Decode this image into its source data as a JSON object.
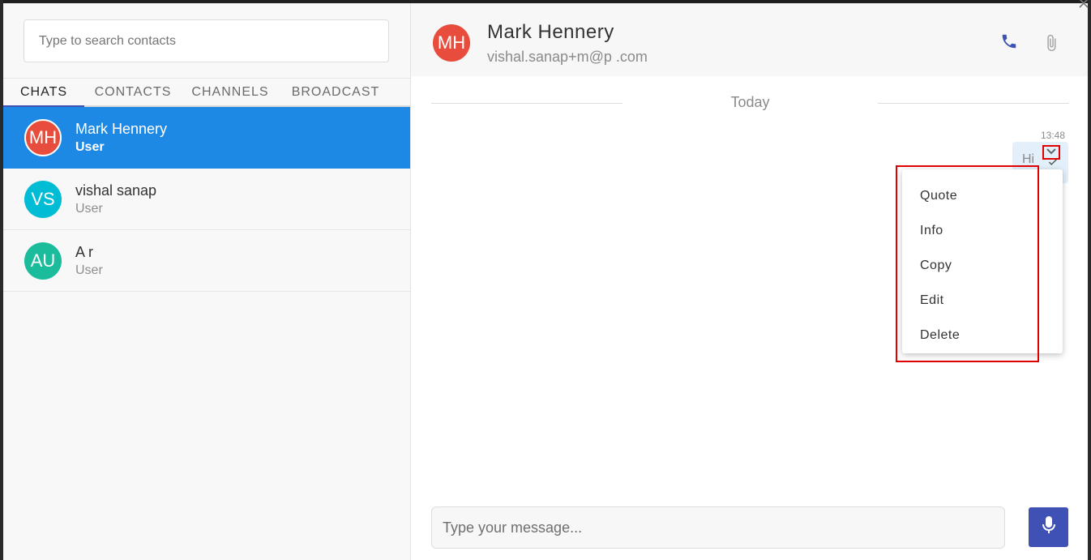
{
  "search": {
    "placeholder": "Type to search contacts"
  },
  "tabs": [
    {
      "label": "CHATS",
      "active": true
    },
    {
      "label": "CONTACTS"
    },
    {
      "label": "CHANNELS"
    },
    {
      "label": "BROADCAST"
    }
  ],
  "chats": [
    {
      "initials": "MH",
      "name": "Mark Hennery",
      "role": "User",
      "color": "#e74c3c",
      "active": true
    },
    {
      "initials": "VS",
      "name": "vishal sanap",
      "role": "User",
      "color": "#00bcd4"
    },
    {
      "initials": "AU",
      "name": "A       r",
      "role": "User",
      "color": "#1abc9c"
    }
  ],
  "header": {
    "initials": "MH",
    "avatar_color": "#e74c3c",
    "name": "Mark Hennery",
    "email": "vishal.sanap+m@p         .com",
    "call_icon": "phone-icon",
    "attach_icon": "paperclip-icon"
  },
  "day_separator": "Today",
  "message": {
    "time": "13:48",
    "text": "Hi",
    "status_icon": "check-icon",
    "menu_icon": "chevron-down-icon"
  },
  "context_menu": {
    "items": [
      "Quote",
      "Info",
      "Copy",
      "Edit",
      "Delete"
    ]
  },
  "composer": {
    "placeholder": "Type your message...",
    "mic_icon": "microphone-icon"
  },
  "colors": {
    "accent": "#3f51b5",
    "active_chat": "#1e88e5",
    "highlight": "#e00000"
  }
}
